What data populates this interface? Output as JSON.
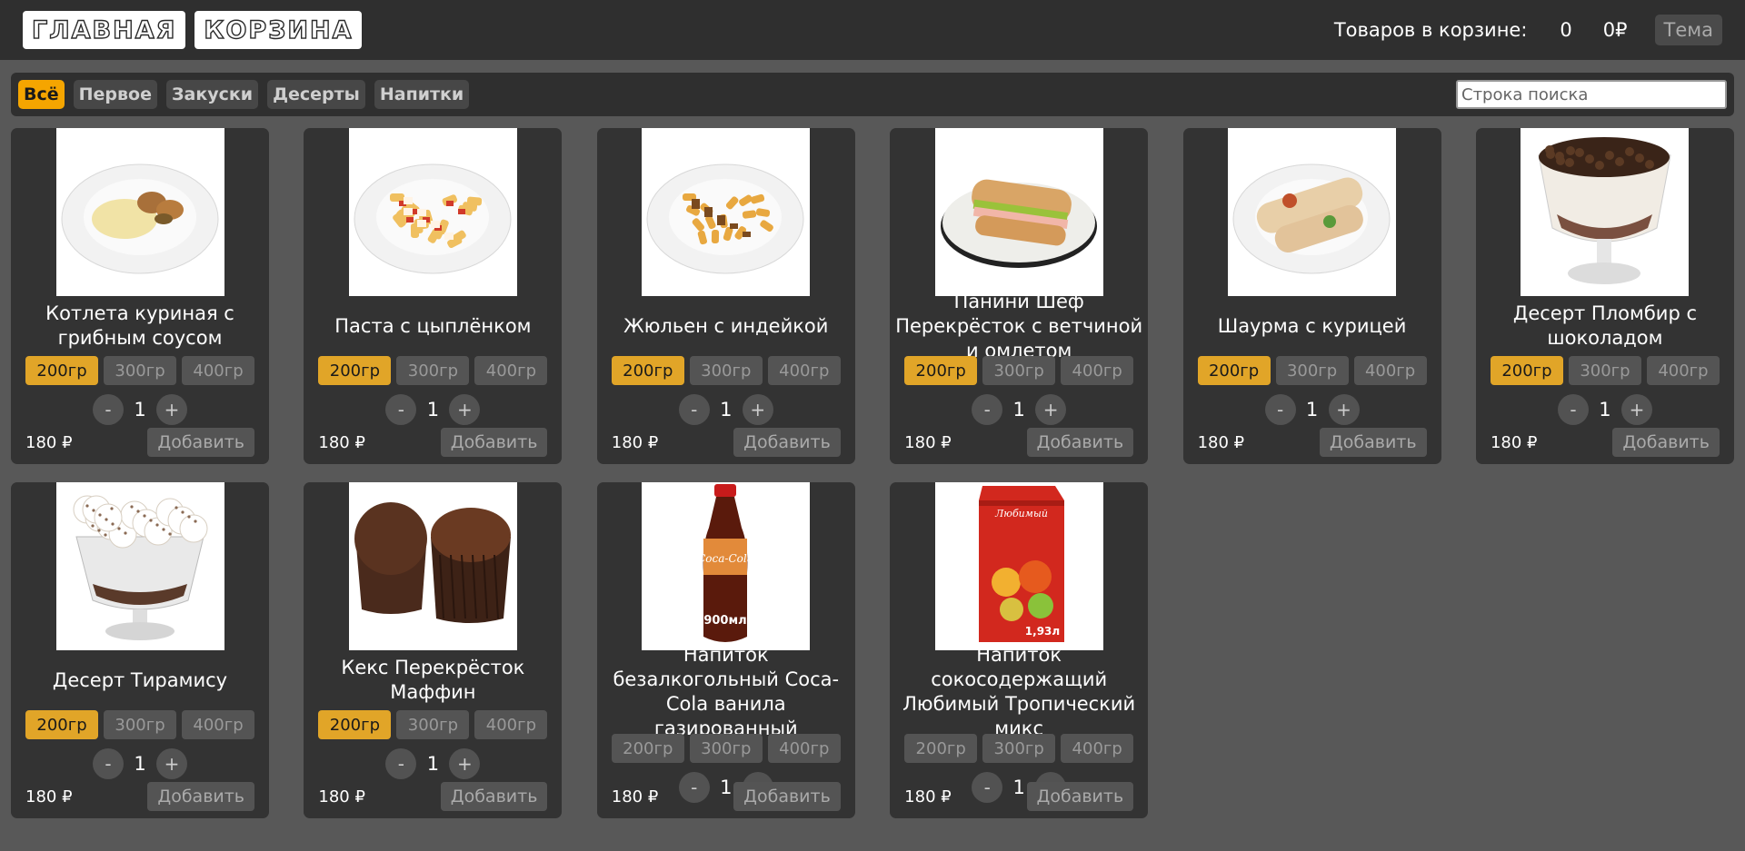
{
  "header": {
    "nav": [
      "ГЛАВНАЯ",
      "КОРЗИНА"
    ],
    "cart_label": "Товаров в корзине:",
    "cart_count": "0",
    "cart_sum": "0₽",
    "theme_label": "Тема"
  },
  "filters": {
    "categories": [
      "Всё",
      "Первое",
      "Закуски",
      "Десерты",
      "Напитки"
    ],
    "active": 0,
    "search_placeholder": "Строка поиска"
  },
  "card_ui": {
    "minus": "-",
    "plus": "+",
    "add_label": "Добавить"
  },
  "products": [
    {
      "name": "Котлета куриная с грибным соусом",
      "sizes": [
        "200гр",
        "300гр",
        "400гр"
      ],
      "selected": 0,
      "qty": "1",
      "price": "180 ₽",
      "icon": "cutlet-plate"
    },
    {
      "name": "Паста с цыплёнком",
      "sizes": [
        "200гр",
        "300гр",
        "400гр"
      ],
      "selected": 0,
      "qty": "1",
      "price": "180 ₽",
      "icon": "pasta-plate"
    },
    {
      "name": "Жюльен с индейкой",
      "sizes": [
        "200гр",
        "300гр",
        "400гр"
      ],
      "selected": 0,
      "qty": "1",
      "price": "180 ₽",
      "icon": "julienne-plate"
    },
    {
      "name": "Панини Шеф Перекрёсток с ветчиной и омлетом",
      "sizes": [
        "200гр",
        "300гр",
        "400гр"
      ],
      "selected": 0,
      "qty": "1",
      "price": "180 ₽",
      "icon": "panini-plate"
    },
    {
      "name": "Шаурма с курицей",
      "sizes": [
        "200гр",
        "300гр",
        "400гр"
      ],
      "selected": 0,
      "qty": "1",
      "price": "180 ₽",
      "icon": "shawarma-plate"
    },
    {
      "name": "Десерт Пломбир с шоколадом",
      "sizes": [
        "200гр",
        "300гр",
        "400гр"
      ],
      "selected": 0,
      "qty": "1",
      "price": "180 ₽",
      "icon": "plombir-dessert"
    },
    {
      "name": "Десерт Тирамису",
      "sizes": [
        "200гр",
        "300гр",
        "400гр"
      ],
      "selected": 0,
      "qty": "1",
      "price": "180 ₽",
      "icon": "tiramisu-dessert"
    },
    {
      "name": "Кекс Перекрёсток Маффин",
      "sizes": [
        "200гр",
        "300гр",
        "400гр"
      ],
      "selected": 0,
      "qty": "1",
      "price": "180 ₽",
      "icon": "muffin"
    },
    {
      "name": "Напиток безалкогольный Coca-Cola ванила газированный",
      "sizes": [
        "200гр",
        "300гр",
        "400гр"
      ],
      "selected": -1,
      "qty": "1",
      "price": "180 ₽",
      "icon": "cola-bottle",
      "img_text": "900мл"
    },
    {
      "name": "Напиток сокосодержащий Любимый Тропический микс",
      "sizes": [
        "200гр",
        "300гр",
        "400гр"
      ],
      "selected": -1,
      "qty": "1",
      "price": "180 ₽",
      "icon": "juice-carton",
      "img_text": "1,93л"
    }
  ]
}
